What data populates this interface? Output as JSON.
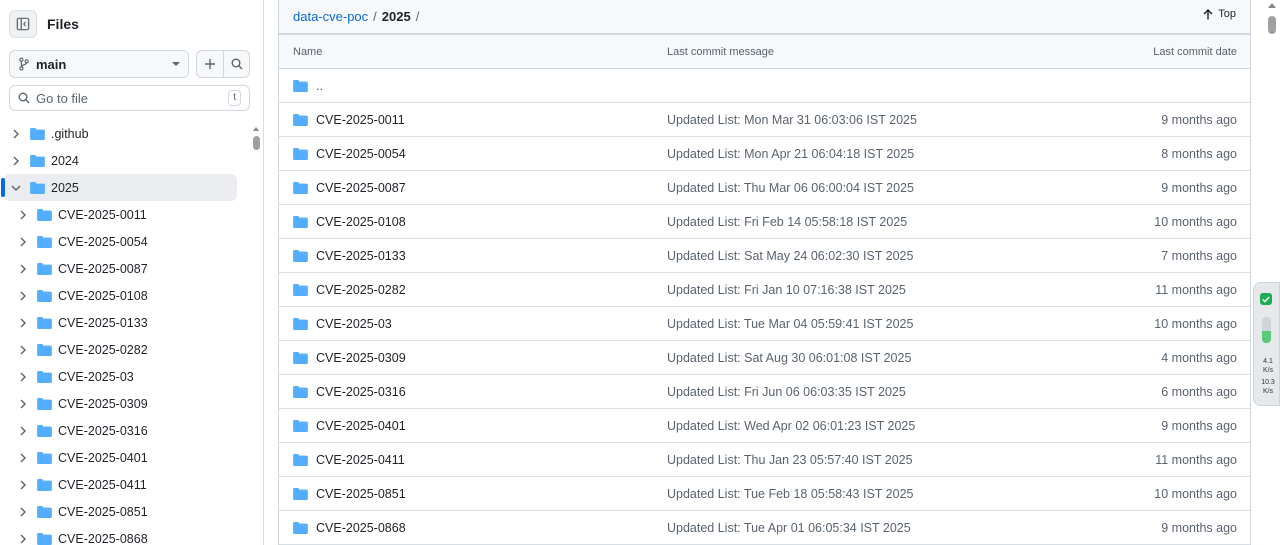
{
  "sidebar": {
    "title": "Files",
    "branch": "main",
    "goto_placeholder": "Go to file",
    "goto_shortcut": "t",
    "tree": [
      {
        "label": ".github",
        "level": 0,
        "expanded": false,
        "selected": false
      },
      {
        "label": "2024",
        "level": 0,
        "expanded": false,
        "selected": false
      },
      {
        "label": "2025",
        "level": 0,
        "expanded": true,
        "selected": true
      },
      {
        "label": "CVE-2025-0011",
        "level": 1,
        "expanded": false,
        "selected": false
      },
      {
        "label": "CVE-2025-0054",
        "level": 1,
        "expanded": false,
        "selected": false
      },
      {
        "label": "CVE-2025-0087",
        "level": 1,
        "expanded": false,
        "selected": false
      },
      {
        "label": "CVE-2025-0108",
        "level": 1,
        "expanded": false,
        "selected": false
      },
      {
        "label": "CVE-2025-0133",
        "level": 1,
        "expanded": false,
        "selected": false
      },
      {
        "label": "CVE-2025-0282",
        "level": 1,
        "expanded": false,
        "selected": false
      },
      {
        "label": "CVE-2025-03",
        "level": 1,
        "expanded": false,
        "selected": false
      },
      {
        "label": "CVE-2025-0309",
        "level": 1,
        "expanded": false,
        "selected": false
      },
      {
        "label": "CVE-2025-0316",
        "level": 1,
        "expanded": false,
        "selected": false
      },
      {
        "label": "CVE-2025-0401",
        "level": 1,
        "expanded": false,
        "selected": false
      },
      {
        "label": "CVE-2025-0411",
        "level": 1,
        "expanded": false,
        "selected": false
      },
      {
        "label": "CVE-2025-0851",
        "level": 1,
        "expanded": false,
        "selected": false
      },
      {
        "label": "CVE-2025-0868",
        "level": 1,
        "expanded": false,
        "selected": false
      }
    ]
  },
  "breadcrumb": {
    "repo": "data-cve-poc",
    "sep1": "/",
    "folder": "2025",
    "sep2": "/"
  },
  "top_label": "Top",
  "table": {
    "headers": {
      "name": "Name",
      "message": "Last commit message",
      "date": "Last commit date"
    },
    "parent": "..",
    "rows": [
      {
        "name": "CVE-2025-0011",
        "message": "Updated List: Mon Mar 31 06:03:06 IST 2025",
        "date": "9 months ago"
      },
      {
        "name": "CVE-2025-0054",
        "message": "Updated List: Mon Apr 21 06:04:18 IST 2025",
        "date": "8 months ago"
      },
      {
        "name": "CVE-2025-0087",
        "message": "Updated List: Thu Mar 06 06:00:04 IST 2025",
        "date": "9 months ago"
      },
      {
        "name": "CVE-2025-0108",
        "message": "Updated List: Fri Feb 14 05:58:18 IST 2025",
        "date": "10 months ago"
      },
      {
        "name": "CVE-2025-0133",
        "message": "Updated List: Sat May 24 06:02:30 IST 2025",
        "date": "7 months ago"
      },
      {
        "name": "CVE-2025-0282",
        "message": "Updated List: Fri Jan 10 07:16:38 IST 2025",
        "date": "11 months ago"
      },
      {
        "name": "CVE-2025-03",
        "message": "Updated List: Tue Mar 04 05:59:41 IST 2025",
        "date": "10 months ago"
      },
      {
        "name": "CVE-2025-0309",
        "message": "Updated List: Sat Aug 30 06:01:08 IST 2025",
        "date": "4 months ago"
      },
      {
        "name": "CVE-2025-0316",
        "message": "Updated List: Fri Jun 06 06:03:35 IST 2025",
        "date": "6 months ago"
      },
      {
        "name": "CVE-2025-0401",
        "message": "Updated List: Wed Apr 02 06:01:23 IST 2025",
        "date": "9 months ago"
      },
      {
        "name": "CVE-2025-0411",
        "message": "Updated List: Thu Jan 23 05:57:40 IST 2025",
        "date": "11 months ago"
      },
      {
        "name": "CVE-2025-0851",
        "message": "Updated List: Tue Feb 18 05:58:43 IST 2025",
        "date": "10 months ago"
      },
      {
        "name": "CVE-2025-0868",
        "message": "Updated List: Tue Apr 01 06:05:34 IST 2025",
        "date": "9 months ago"
      }
    ]
  },
  "widget": {
    "upload_value": "4.1",
    "upload_unit": "K/s",
    "download_value": "10.3",
    "download_unit": "K/s",
    "level": 0.45
  },
  "colors": {
    "accent": "#0969da",
    "folder": "#54aeff",
    "border": "#d0d7de",
    "muted": "#59636e",
    "widget_ok": "#1faa55"
  }
}
